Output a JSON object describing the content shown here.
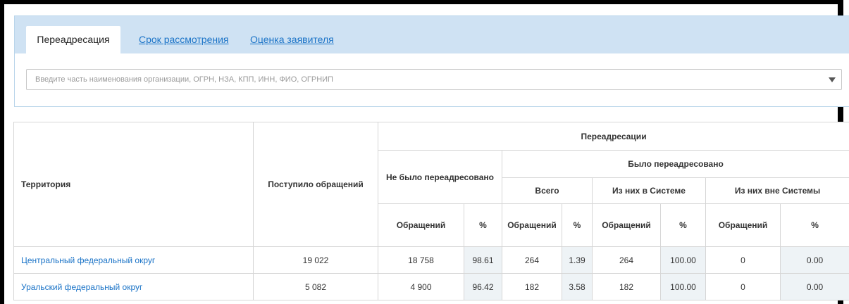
{
  "tabs": [
    {
      "label": "Переадресация",
      "active": true
    },
    {
      "label": "Срок рассмотрения",
      "active": false
    },
    {
      "label": "Оценка заявителя",
      "active": false
    }
  ],
  "search": {
    "placeholder": "Введите часть наименования организации, ОГРН, НЗА, КПП, ИНН, ФИО, ОГРНИП",
    "value": ""
  },
  "table": {
    "headers": {
      "territory": "Территория",
      "received": "Поступило обращений",
      "redirects": "Переадресации",
      "not_redirected": "Не было переадресовано",
      "was_redirected": "Было переадресовано",
      "total": "Всего",
      "in_system": "Из них в Системе",
      "outside_system": "Из них вне Системы",
      "requests": "Обращений",
      "percent": "%"
    },
    "rows": [
      {
        "territory": "Центральный федеральный округ",
        "received": "19 022",
        "not_redirected_count": "18 758",
        "not_redirected_pct": "98.61",
        "total_count": "264",
        "total_pct": "1.39",
        "in_system_count": "264",
        "in_system_pct": "100.00",
        "outside_count": "0",
        "outside_pct": "0.00"
      },
      {
        "territory": "Уральский федеральный округ",
        "received": "5 082",
        "not_redirected_count": "4 900",
        "not_redirected_pct": "96.42",
        "total_count": "182",
        "total_pct": "3.58",
        "in_system_count": "182",
        "in_system_pct": "100.00",
        "outside_count": "0",
        "outside_pct": "0.00"
      }
    ]
  }
}
